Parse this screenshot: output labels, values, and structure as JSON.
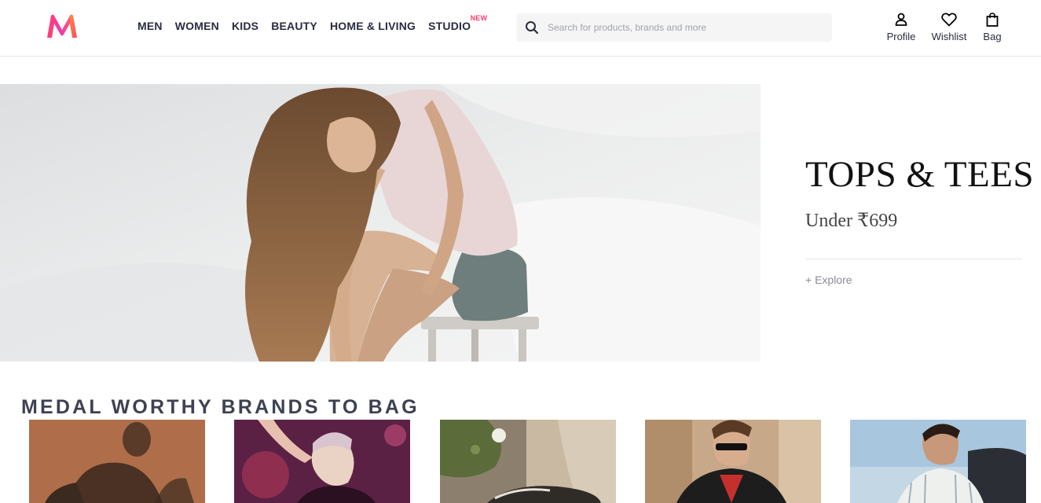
{
  "header": {
    "nav": [
      {
        "label": "MEN"
      },
      {
        "label": "WOMEN"
      },
      {
        "label": "KIDS"
      },
      {
        "label": "BEAUTY"
      },
      {
        "label": "HOME & LIVING"
      },
      {
        "label": "STUDIO",
        "badge": "NEW"
      }
    ],
    "search": {
      "placeholder": "Search for products, brands and more",
      "icon": "search-icon"
    },
    "actions": [
      {
        "label": "Profile",
        "icon": "profile-icon"
      },
      {
        "label": "Wishlist",
        "icon": "heart-icon"
      },
      {
        "label": "Bag",
        "icon": "bag-icon"
      }
    ]
  },
  "hero": {
    "title": "TOPS & TEES",
    "subtitle": "Under ₹699",
    "cta": "+ Explore"
  },
  "brands": {
    "title": "MEDAL WORTHY BRANDS TO BAG"
  },
  "colors": {
    "brand_accent": "#ff3f6c",
    "text_primary": "#282c3f",
    "search_bg": "#f5f5f6"
  }
}
